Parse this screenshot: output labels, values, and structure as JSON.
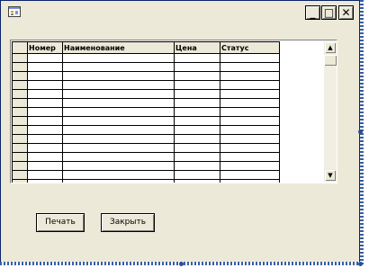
{
  "window": {
    "title": ""
  },
  "titlebar_buttons": {
    "minimize": "_",
    "maximize": "□",
    "close": "✕"
  },
  "grid": {
    "columns": [
      "",
      "Номер",
      "Наименование",
      "Цена",
      "Статус"
    ],
    "row_count": 15,
    "scroll_up": "▲",
    "scroll_down": "▼"
  },
  "buttons": {
    "print_label": "Печать",
    "close_label": "Закрыть"
  },
  "colors": {
    "window_bg": "#ece9d8",
    "grid_bg": "#ffffff",
    "frame_blue": "#0a246a"
  }
}
